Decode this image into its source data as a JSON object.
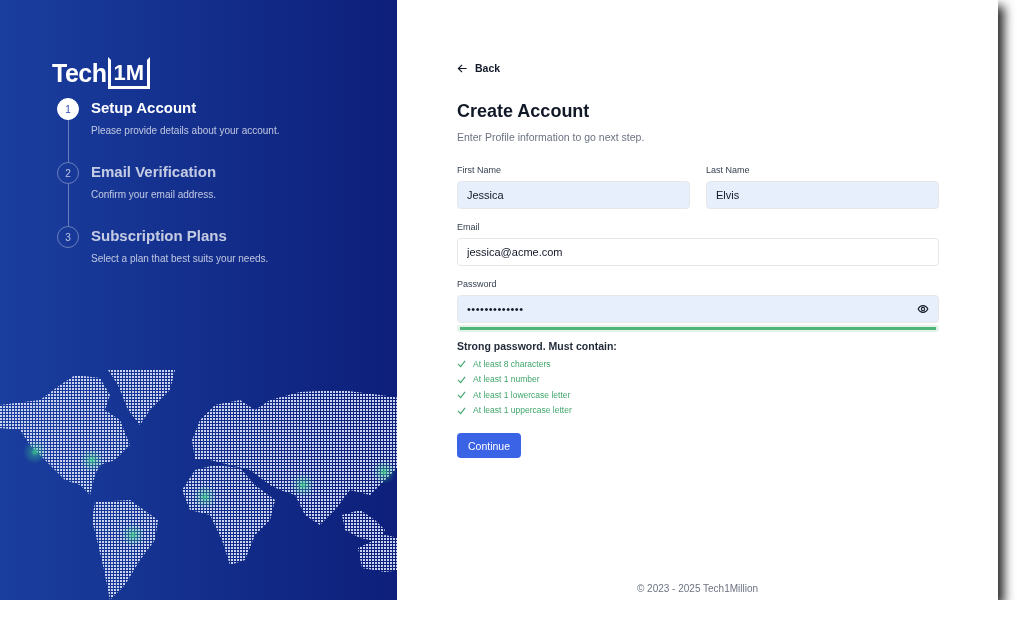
{
  "brand": {
    "word": "Tech",
    "mark": "1M"
  },
  "steps": [
    {
      "number": "1",
      "title": "Setup Account",
      "description": "Please provide details about your account.",
      "selected": true
    },
    {
      "number": "2",
      "title": "Email Verification",
      "description": "Confirm your email address.",
      "selected": false
    },
    {
      "number": "3",
      "title": "Subscription Plans",
      "description": "Select a plan that best suits your needs.",
      "selected": false
    }
  ],
  "back": {
    "label": "Back"
  },
  "form": {
    "title": "Create Account",
    "subtitle": "Enter Profile information to go next step.",
    "first_name": {
      "label": "First Name",
      "value": "Jessica"
    },
    "last_name": {
      "label": "Last Name",
      "value": "Elvis"
    },
    "email": {
      "label": "Email",
      "value": "jessica@acme.com"
    },
    "password": {
      "label": "Password",
      "value": "•••••••••••••"
    },
    "strength": {
      "level": 1,
      "message": "Strong password. Must contain:"
    },
    "requirements": [
      {
        "text": "At least 8 characters",
        "met": true
      },
      {
        "text": "At least 1 number",
        "met": true
      },
      {
        "text": "At least 1 lowercase letter",
        "met": true
      },
      {
        "text": "At least 1 uppercase letter",
        "met": true
      }
    ],
    "submit": "Continue"
  },
  "footer": "© 2023 - 2025 Tech1Million"
}
